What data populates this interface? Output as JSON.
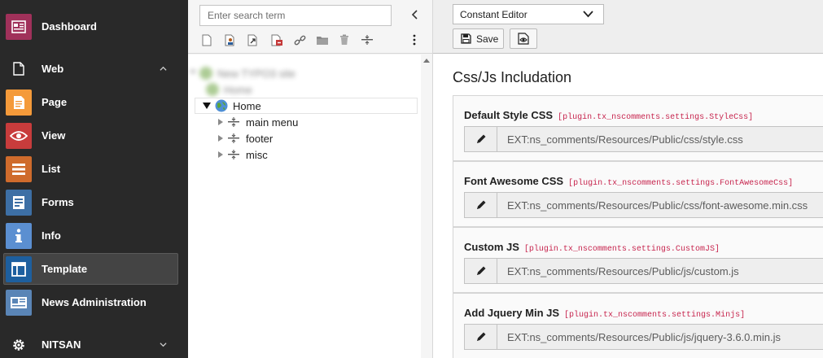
{
  "module_menu": {
    "items": [
      {
        "label": "Dashboard",
        "icon": "dashboard-icon",
        "color": "#a0315a"
      },
      {
        "label": "Web",
        "icon": "page-outline-icon",
        "group": true
      },
      {
        "label": "Page",
        "icon": "page-module-icon",
        "color": "#f49a3a"
      },
      {
        "label": "View",
        "icon": "eye-icon",
        "color": "#c83c3c"
      },
      {
        "label": "List",
        "icon": "list-icon",
        "color": "#cf6b2c"
      },
      {
        "label": "Forms",
        "icon": "forms-icon",
        "color": "#3d6fa5"
      },
      {
        "label": "Info",
        "icon": "info-icon",
        "color": "#5b8fd1"
      },
      {
        "label": "Template",
        "icon": "template-icon",
        "color": "#1d5f9f",
        "active": true
      },
      {
        "label": "News Administration",
        "icon": "news-icon",
        "color": "#5a85b6"
      },
      {
        "label": "NITSAN",
        "icon": "gear-icon",
        "group": true
      }
    ]
  },
  "page_tree": {
    "search_placeholder": "Enter search term",
    "nodes": [
      {
        "label": "New TYPO3 site"
      },
      {
        "label": "Home"
      },
      {
        "label": "main menu"
      },
      {
        "label": "footer"
      },
      {
        "label": "misc"
      }
    ],
    "blurred_child": "Home"
  },
  "docheader": {
    "function_menu_value": "Constant Editor",
    "save_label": "Save"
  },
  "main": {
    "section_title": "Css/Js Includation",
    "fields": [
      {
        "label": "Default Style CSS",
        "key": "[plugin.tx_nscomments.settings.StyleCss]",
        "value": "EXT:ns_comments/Resources/Public/css/style.css"
      },
      {
        "label": "Font Awesome CSS",
        "key": "[plugin.tx_nscomments.settings.FontAwesomeCss]",
        "value": "EXT:ns_comments/Resources/Public/css/font-awesome.min.css"
      },
      {
        "label": "Custom JS",
        "key": "[plugin.tx_nscomments.settings.CustomJS]",
        "value": "EXT:ns_comments/Resources/Public/js/custom.js"
      },
      {
        "label": "Add Jquery Min JS",
        "key": "[plugin.tx_nscomments.settings.Minjs]",
        "value": "EXT:ns_comments/Resources/Public/js/jquery-3.6.0.min.js"
      }
    ]
  }
}
